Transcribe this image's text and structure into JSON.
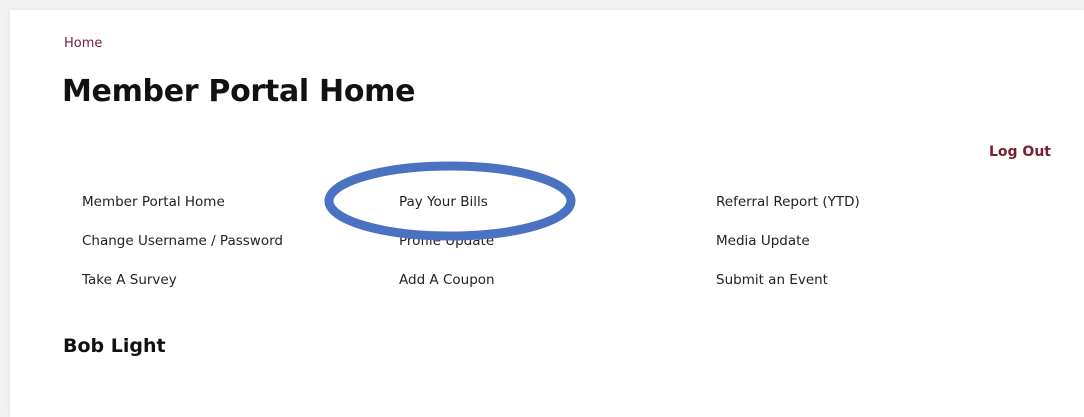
{
  "breadcrumb": {
    "home": "Home"
  },
  "page_title": "Member Portal Home",
  "logout_label": "Log Out",
  "nav": {
    "col1": [
      "Member Portal Home",
      "Change Username / Password",
      "Take A Survey"
    ],
    "col2": [
      "Pay Your Bills",
      "Profile Update",
      "Add A Coupon"
    ],
    "col3": [
      "Referral Report (YTD)",
      "Media Update",
      "Submit an Event"
    ]
  },
  "member_name": "Bob Light",
  "colors": {
    "accent": "#7a2036",
    "annotation": "#4a72c0"
  }
}
